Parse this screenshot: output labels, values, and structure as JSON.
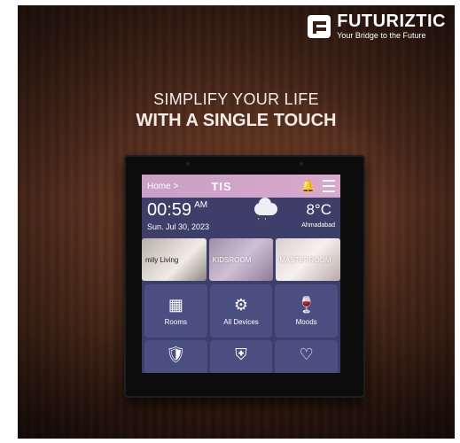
{
  "brand": {
    "name": "FUTURIZTIC",
    "tagline": "Your Bridge to the Future"
  },
  "headline": {
    "line1": "SIMPLIFY YOUR LIFE",
    "line2": "WITH A SINGLE TOUCH"
  },
  "panel": {
    "topbar": {
      "home": "Home >",
      "logo": "TIS",
      "bell_icon": "bell-icon",
      "menu_icon": "menu-icon"
    },
    "info": {
      "time": "00:59",
      "ampm": "AM",
      "date": "Sun. Jul 30, 2023",
      "weather_icon": "rain-cloud-icon",
      "temperature": "8°C",
      "city": "Ahmadabad"
    },
    "rooms": [
      {
        "label": "mily Living"
      },
      {
        "label": "KIDSROOM"
      },
      {
        "label": "MASTERROOM"
      }
    ],
    "tiles": [
      {
        "label": "Rooms",
        "icon": "rooms-icon",
        "glyph": "▦"
      },
      {
        "label": "All Devices",
        "icon": "sliders-icon",
        "glyph": "⚙"
      },
      {
        "label": "Moods",
        "icon": "glasses-icon",
        "glyph": "🍷"
      },
      {
        "label": "",
        "icon": "shield-check-icon",
        "glyph": "🛡"
      },
      {
        "label": "",
        "icon": "security-icon",
        "glyph": "⛨"
      },
      {
        "label": "",
        "icon": "heart-pulse-icon",
        "glyph": "♡"
      }
    ]
  }
}
